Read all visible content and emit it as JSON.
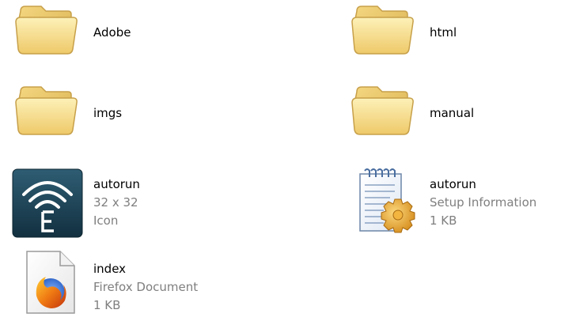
{
  "files": [
    {
      "name": "Adobe",
      "type": "folder"
    },
    {
      "name": "html",
      "type": "folder"
    },
    {
      "name": "imgs",
      "type": "folder"
    },
    {
      "name": "manual",
      "type": "folder"
    },
    {
      "name": "autorun",
      "detail1": "32 x 32",
      "detail2": "Icon",
      "icon": "wireless-e-icon"
    },
    {
      "name": "autorun",
      "detail1": "Setup Information",
      "detail2": "1 KB",
      "icon": "setup-info-icon"
    },
    {
      "name": "index",
      "detail1": "Firefox Document",
      "detail2": "1 KB",
      "icon": "firefox-document-icon"
    }
  ],
  "colors": {
    "folder_light": "#fbe9a4",
    "folder_dark": "#e5c160",
    "folder_outline": "#c7a04a",
    "meta_text": "#7f7f7f",
    "ico_bg": "#1f3f52"
  }
}
